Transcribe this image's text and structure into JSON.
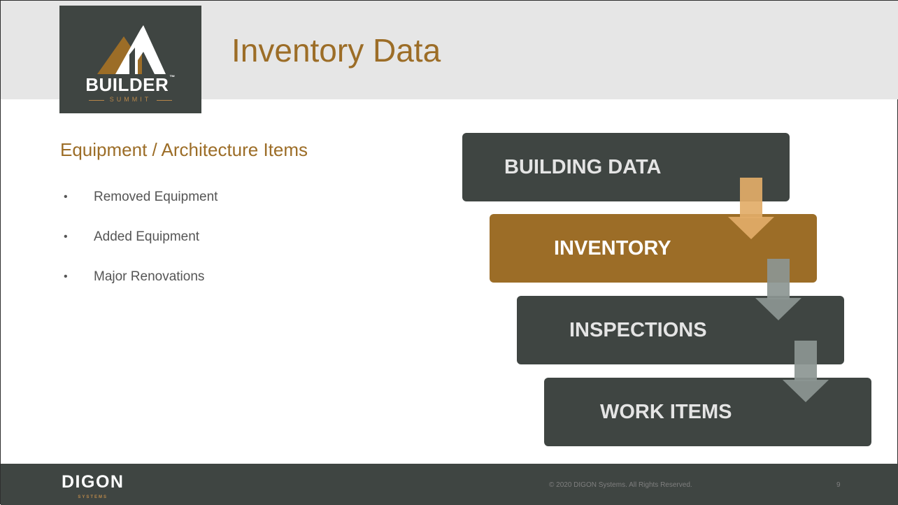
{
  "header": {
    "title": "Inventory Data",
    "logo": {
      "word": "BUILDER",
      "trademark": "™",
      "sub": "SUMMIT"
    }
  },
  "content": {
    "heading": "Equipment / Architecture Items",
    "bullets": [
      "Removed Equipment",
      "Added Equipment",
      "Major Renovations"
    ]
  },
  "flow": {
    "steps": [
      "BUILDING DATA",
      "INVENTORY",
      "INSPECTIONS",
      "WORK ITEMS"
    ],
    "highlighted_step": "INVENTORY"
  },
  "colors": {
    "accent": "#9c6d27",
    "dark": "#3f4542",
    "header_band": "#e6e6e6"
  },
  "footer": {
    "logo": {
      "word": "DIGON",
      "sub": "SYSTEMS"
    },
    "copyright": "© 2020 DIGON Systems.  All Rights Reserved.",
    "page_number": "9"
  }
}
